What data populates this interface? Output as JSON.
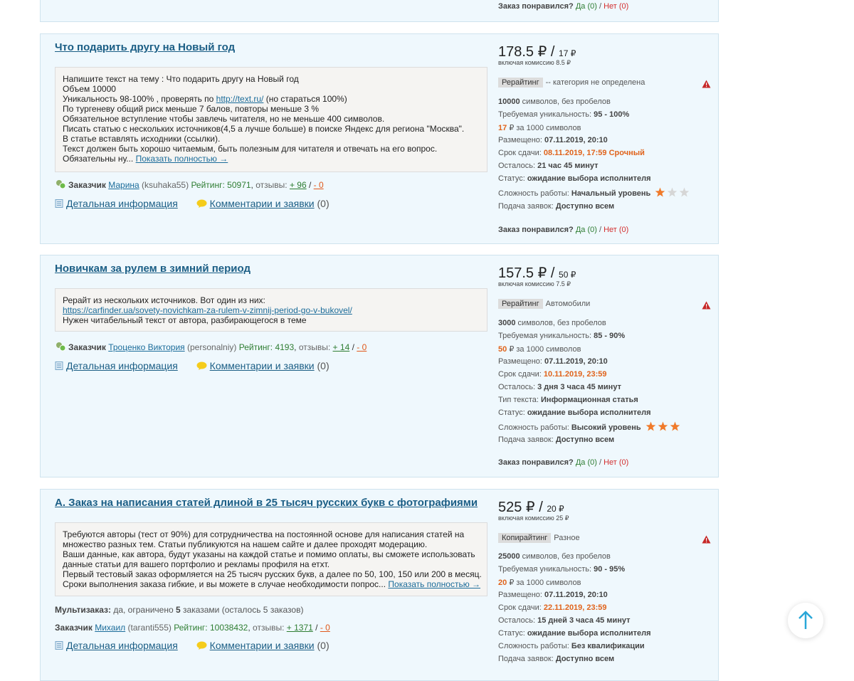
{
  "ui": {
    "liked_label": "Заказ понравился?",
    "yes_label": "Да",
    "no_label": "Нет",
    "customer_label": "Заказчик",
    "rating_label": "Рейтинг:",
    "reviews_label": "отзывы:",
    "details_label": "Детальная информация",
    "comments_label": "Комментарии и заявки",
    "show_more": "Показать полностью →",
    "commission_label": "включая комиссию",
    "chars_label": "символов, без пробелов",
    "uniq_label": "Требуемая уникальность:",
    "per_1000_label": "за 1000 символов",
    "posted_label": "Размещено:",
    "deadline_label": "Срок сдачи:",
    "left_label": "Осталось:",
    "text_type_label": "Тип текста:",
    "status_label": "Статус:",
    "difficulty_label": "Сложность работы:",
    "apply_label": "Подача заявок:",
    "multi_label": "Мультизаказ:",
    "scroll_top": "↑",
    "colors": {
      "accent": "#1b5e85",
      "orange": "#e0631b",
      "green": "#2e7d32",
      "red": "#d32f2f",
      "card_bg": "#eff8fd"
    }
  },
  "top_card": {
    "likes": "(0)",
    "dislikes": "(0)"
  },
  "orders": [
    {
      "title": "Что подарить другу на Новый год",
      "desc_lines": [
        "Напишите текст на тему : Что подарить другу на Новый год",
        "Объем 10000",
        "Уникальность 98-100% , проверять по ",
        "По тургеневу общий риск меньше 7 балов, повторы меньше 3 %",
        "Обязательное вступление чтобы завлечь читателя, но не меньше 400 символов.",
        "Писать статью с нескольких источников(4,5 а лучше больше) в поиске Яндекс для региона \"Москва\".",
        "В статье вставлять исходники (ссылки).",
        "Текст должен быть хорошо читаемым, быть полезным для читателя и отвечать на его вопрос.",
        "Обязательны ну..."
      ],
      "desc_link": "http://text.ru/",
      "desc_link_after": " (но стараться 100%)",
      "customer_name": "Марина",
      "customer_login": "(ksuhaka55)",
      "rating": "50971",
      "reviews_plus": "+ 96",
      "reviews_minus": "- 0",
      "comments_count": "(0)",
      "price": "178.5 ₽",
      "price_sep": "/",
      "price_per": "17 ₽",
      "commission": "8.5 ₽",
      "tag": "Рерайтинг",
      "category": "-- категория не определена",
      "chars": "10000",
      "uniq": "95 - 100%",
      "per_1000": "17",
      "currency": "₽",
      "posted": "07.11.2019, 20:10",
      "deadline": "08.11.2019, 17:59 Срочный",
      "left": "21 час 45 минут",
      "status": "ожидание выбора исполнителя",
      "difficulty": "Начальный уровень",
      "difficulty_stars": 1,
      "apply": "Доступно всем",
      "likes": "(0)",
      "dislikes": "(0)"
    },
    {
      "title": "Новичкам за рулем в зимний период",
      "desc_lines": [
        "Рерайт из нескольких источников. Вот один из них:",
        "Нужен читабельный текст от автора, разбирающегося в теме"
      ],
      "desc_link": "https://carfinder.ua/sovety-novichkam-za-rulem-v-zimnij-period-go-v-bukovel/",
      "customer_name": "Троценко Виктория",
      "customer_login": "(personalniy)",
      "rating": "4193",
      "reviews_plus": "+ 14",
      "reviews_minus": "- 0",
      "comments_count": "(0)",
      "price": "157.5 ₽",
      "price_sep": "/",
      "price_per": "50 ₽",
      "commission": "7.5 ₽",
      "tag": "Рерайтинг",
      "category": "Автомобили",
      "chars": "3000",
      "uniq": "85 - 90%",
      "per_1000": "50",
      "currency": "₽",
      "posted": "07.11.2019, 20:10",
      "deadline": "10.11.2019, 23:59",
      "left": "3 дня 3 часа 45 минут",
      "text_type": "Информационная статья",
      "status": "ожидание выбора исполнителя",
      "difficulty": "Высокий уровень",
      "difficulty_stars": 3,
      "apply": "Доступно всем",
      "likes": "(0)",
      "dislikes": "(0)"
    },
    {
      "title": "А. Заказ на написания статей длиной в 25 тысяч русских букв с фотографиями",
      "desc_lines": [
        "Требуются авторы (тест от 90%) для сотрудничества на постоянной основе для написания статей на",
        "множество разных тем. Статьи публикуются на нашем сайте и далее проходят модерацию.",
        "Ваши данные, как автора, будут указаны на каждой статье и помимо оплаты, вы сможете использовать",
        "данные статьи для вашего портфолио и рекламы профиля на етхт.",
        "Первый тестовый заказ оформляется на 25 тысяч русских букв, а далее по 50, 100, 150 или 200 в месяц.",
        "Сроки выполнения заказа гибкие, и вы можете в случае необходимости попрос..."
      ],
      "multi_value_pre": "да, ограничено",
      "multi_count": "5",
      "multi_value_post": "заказами (осталось 5 заказов)",
      "customer_name": "Михаил",
      "customer_login": "(taranti555)",
      "rating": "10038432",
      "reviews_plus": "+ 1371",
      "reviews_minus": "- 0",
      "comments_count": "(0)",
      "price": "525 ₽",
      "price_sep": "/",
      "price_per": "20 ₽",
      "commission": "25 ₽",
      "tag": "Копирайтинг",
      "category": "Разное",
      "chars": "25000",
      "uniq": "90 - 95%",
      "per_1000": "20",
      "currency": "₽",
      "posted": "07.11.2019, 20:10",
      "deadline": "22.11.2019, 23:59",
      "left": "15 дней 3 часа 45 минут",
      "status": "ожидание выбора исполнителя",
      "difficulty": "Без квалификации",
      "apply": "Доступно всем"
    }
  ]
}
